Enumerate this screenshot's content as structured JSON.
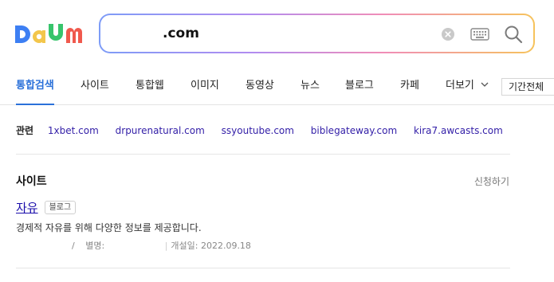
{
  "header": {
    "logo_text": "Daum",
    "search": {
      "value": ".com",
      "placeholder": ""
    },
    "icons": {
      "clear": "clear-circle-icon",
      "keyboard": "keyboard-icon",
      "search": "search-icon"
    }
  },
  "tabs": {
    "items": [
      {
        "label": "통합검색",
        "active": true
      },
      {
        "label": "사이트",
        "active": false
      },
      {
        "label": "통합웹",
        "active": false
      },
      {
        "label": "이미지",
        "active": false
      },
      {
        "label": "동영상",
        "active": false
      },
      {
        "label": "뉴스",
        "active": false
      },
      {
        "label": "블로그",
        "active": false
      },
      {
        "label": "카페",
        "active": false
      },
      {
        "label": "더보기",
        "active": false
      }
    ],
    "period_select": "기간전체"
  },
  "related": {
    "label": "관련",
    "links": [
      "1xbet.com",
      "drpurenatural.com",
      "ssyoutube.com",
      "biblegateway.com",
      "kira7.awcasts.com"
    ]
  },
  "site_section": {
    "title": "사이트",
    "apply_label": "신청하기",
    "result": {
      "title": "자유",
      "badge": "블로그",
      "description": "경제적 자유를 위해 다양한 정보를 제공합니다.",
      "meta_slash": "/",
      "alias_label": "별명:",
      "opened": "개설일: 2022.09.18"
    }
  },
  "colors": {
    "accent": "#2b71d9",
    "link": "#3420a8",
    "logo_d": "#3d7ff3",
    "logo_a": "#f3c64b",
    "logo_u": "#37c46c",
    "logo_m": "#f0594d"
  }
}
